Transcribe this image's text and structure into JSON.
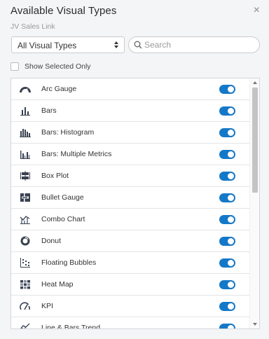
{
  "header": {
    "title": "Available Visual Types",
    "subtitle": "JV Sales Link",
    "close_glyph": "×"
  },
  "filter": {
    "selected": "All Visual Types"
  },
  "search": {
    "placeholder": "Search",
    "value": ""
  },
  "show_selected": {
    "label": "Show Selected Only",
    "checked": false
  },
  "visual_types": [
    {
      "label": "Arc Gauge",
      "icon": "arc-gauge-icon",
      "enabled": true
    },
    {
      "label": "Bars",
      "icon": "bars-icon",
      "enabled": true
    },
    {
      "label": "Bars: Histogram",
      "icon": "histogram-icon",
      "enabled": true
    },
    {
      "label": "Bars: Multiple Metrics",
      "icon": "multi-bars-icon",
      "enabled": true
    },
    {
      "label": "Box Plot",
      "icon": "box-plot-icon",
      "enabled": true
    },
    {
      "label": "Bullet Gauge",
      "icon": "bullet-gauge-icon",
      "enabled": true
    },
    {
      "label": "Combo Chart",
      "icon": "combo-chart-icon",
      "enabled": true
    },
    {
      "label": "Donut",
      "icon": "donut-icon",
      "enabled": true
    },
    {
      "label": "Floating Bubbles",
      "icon": "floating-bubbles-icon",
      "enabled": true
    },
    {
      "label": "Heat Map",
      "icon": "heat-map-icon",
      "enabled": true
    },
    {
      "label": "KPI",
      "icon": "kpi-icon",
      "enabled": true
    },
    {
      "label": "Line & Bars Trend",
      "icon": "line-bars-trend-icon",
      "enabled": true
    }
  ],
  "colors": {
    "toggle_on": "#1478c8",
    "icon": "#3a4250"
  }
}
